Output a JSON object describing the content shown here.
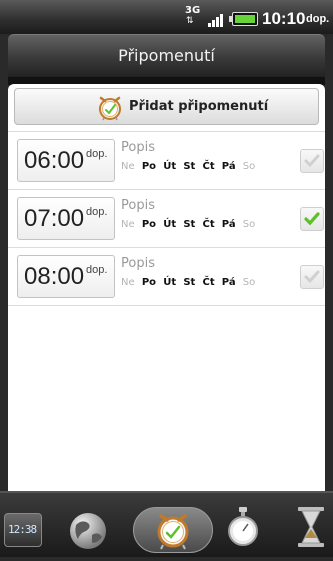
{
  "status_bar": {
    "network": "3G",
    "time": "10:10",
    "ampm": "dop."
  },
  "title": "Připomenutí",
  "add_button_label": "Přidat připomenutí",
  "alarms": [
    {
      "time": "06:00",
      "ampm": "dop.",
      "description": "Popis",
      "days": [
        {
          "label": "Ne",
          "active": false
        },
        {
          "label": "Po",
          "active": true
        },
        {
          "label": "Út",
          "active": true
        },
        {
          "label": "St",
          "active": true
        },
        {
          "label": "Čt",
          "active": true
        },
        {
          "label": "Pá",
          "active": true
        },
        {
          "label": "So",
          "active": false
        }
      ],
      "enabled": false
    },
    {
      "time": "07:00",
      "ampm": "dop.",
      "description": "Popis",
      "days": [
        {
          "label": "Ne",
          "active": false
        },
        {
          "label": "Po",
          "active": true
        },
        {
          "label": "Út",
          "active": true
        },
        {
          "label": "St",
          "active": true
        },
        {
          "label": "Čt",
          "active": true
        },
        {
          "label": "Pá",
          "active": true
        },
        {
          "label": "So",
          "active": false
        }
      ],
      "enabled": true
    },
    {
      "time": "08:00",
      "ampm": "dop.",
      "description": "Popis",
      "days": [
        {
          "label": "Ne",
          "active": false
        },
        {
          "label": "Po",
          "active": true
        },
        {
          "label": "Út",
          "active": true
        },
        {
          "label": "St",
          "active": true
        },
        {
          "label": "Čt",
          "active": true
        },
        {
          "label": "Pá",
          "active": true
        },
        {
          "label": "So",
          "active": false
        }
      ],
      "enabled": false
    }
  ],
  "tabs": [
    {
      "name": "desk-clock",
      "icon": "digital-clock-icon",
      "digits": "12:38",
      "selected": false
    },
    {
      "name": "world-clock",
      "icon": "globe-icon",
      "selected": false
    },
    {
      "name": "alarms",
      "icon": "alarm-clock-icon",
      "selected": true
    },
    {
      "name": "stopwatch",
      "icon": "stopwatch-icon",
      "selected": false
    },
    {
      "name": "timer",
      "icon": "hourglass-icon",
      "selected": false
    }
  ],
  "colors": {
    "check_on": "#5cc12a",
    "check_off": "#d0d0d0",
    "battery": "#66d33b"
  }
}
